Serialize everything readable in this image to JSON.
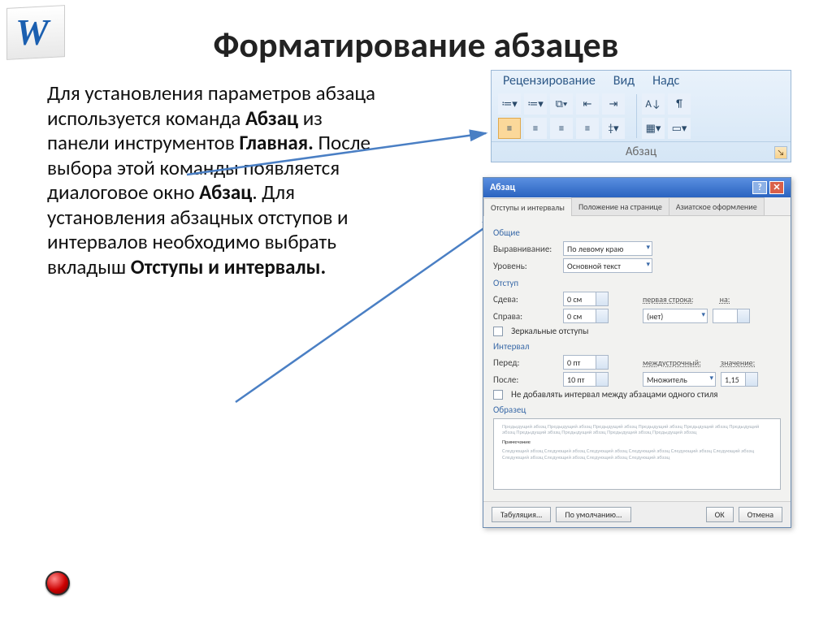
{
  "title": "Форматирование абзацев",
  "body": {
    "p1a": "Для установления параметров абзаца используется команда ",
    "b1": "Абзац",
    "p1b": " из панели инструментов ",
    "b2": "Главная.",
    "p2a": " После выбора этой команды появляется диалоговое окно ",
    "b3": "Абзац",
    "p2b": ". Для установления абзацных отступов и интервалов необходимо выбрать вкладыш ",
    "b4": "Отступы и интервалы."
  },
  "ribbon": {
    "tabs": [
      "Рецензирование",
      "Вид",
      "Надс"
    ],
    "footer": "Абзац",
    "icons_row1": [
      "≔▾",
      "≔▾",
      "⧉▾",
      "⇤",
      "⇥"
    ],
    "icons_row2_left": [
      "≡",
      "≡",
      "≡",
      "≡",
      "‡▾"
    ],
    "icons_row1_right": [
      "A↓",
      "¶"
    ],
    "icons_row2_right": [
      "▦▾",
      "▭▾"
    ]
  },
  "dialog": {
    "title": "Абзац",
    "tabs": [
      "Отступы и интервалы",
      "Положение на странице",
      "Азиатское оформление"
    ],
    "groups": {
      "general": "Общие",
      "indent": "Отступ",
      "interval": "Интервал",
      "sample": "Образец"
    },
    "general": {
      "align_label": "Выравнивание:",
      "align_value": "По левому краю",
      "level_label": "Уровень:",
      "level_value": "Основной текст"
    },
    "indent": {
      "left_label": "Сдева:",
      "left_value": "0 см",
      "right_label": "Справа:",
      "right_value": "0 см",
      "firstline_label": "первая строка:",
      "firstline_value": "(нет)",
      "by_label": "на:",
      "mirror": "Зеркальные отступы"
    },
    "interval": {
      "before_label": "Перед:",
      "before_value": "0 пт",
      "after_label": "После:",
      "after_value": "10 пт",
      "linespacing_label": "междустрочный:",
      "linespacing_value": "Множитель",
      "value_label": "значение:",
      "value_value": "1,15",
      "noadd": "Не добавлять интервал между абзацами одного стиля"
    },
    "sample_text": {
      "grey1": "Предыдущий абзац Предыдущий абзац Предыдущий абзац Предыдущий абзац Предыдущий абзац Предыдущий абзац Предыдущий абзац Предыдущий абзац Предыдущий абзац Предыдущий абзац",
      "dark": "Примечание",
      "grey2": "Следующий абзац Следующий абзац Следующий абзац Следующий абзац Следующий абзац Следующий абзац Следующий абзац Следующий абзац Следующий абзац Следующий абзац"
    },
    "buttons": {
      "tabs": "Табуляция...",
      "default": "По умолчанию...",
      "ok": "ОК",
      "cancel": "Отмена"
    }
  }
}
